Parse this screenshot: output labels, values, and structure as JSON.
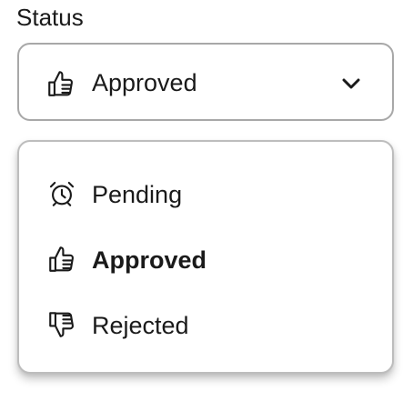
{
  "field": {
    "label": "Status"
  },
  "select": {
    "value": "Approved",
    "value_icon": "thumbs-up-icon",
    "border_color": "#a8a8a8"
  },
  "menu": {
    "items": [
      {
        "label": "Pending",
        "icon": "alarm-clock-icon",
        "selected": false
      },
      {
        "label": "Approved",
        "icon": "thumbs-up-icon",
        "selected": true
      },
      {
        "label": "Rejected",
        "icon": "thumbs-down-icon",
        "selected": false
      }
    ]
  }
}
